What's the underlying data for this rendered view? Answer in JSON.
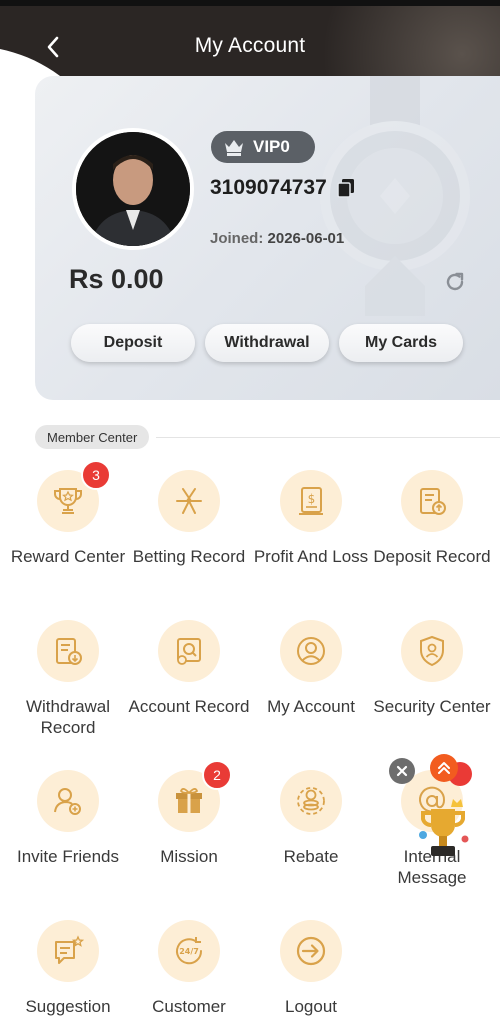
{
  "header": {
    "title": "My Account"
  },
  "profile": {
    "vip_label": "VIP0",
    "user_id": "3109074737",
    "joined_label": "Joined:",
    "joined_date": "2026-06-01",
    "balance": "Rs 0.00"
  },
  "actions": {
    "deposit": "Deposit",
    "withdrawal": "Withdrawal",
    "my_cards": "My Cards"
  },
  "section": {
    "member_center": "Member Center"
  },
  "menu": [
    {
      "label": "Reward Center",
      "icon": "trophy-icon",
      "badge": "3"
    },
    {
      "label": "Betting Record",
      "icon": "betting-record-icon"
    },
    {
      "label": "Profit And Loss",
      "icon": "profit-loss-icon"
    },
    {
      "label": "Deposit Record",
      "icon": "deposit-record-icon"
    },
    {
      "label": "Withdrawal Record",
      "icon": "withdrawal-record-icon"
    },
    {
      "label": "Account Record",
      "icon": "account-record-icon"
    },
    {
      "label": "My Account",
      "icon": "user-icon"
    },
    {
      "label": "Security Center",
      "icon": "shield-icon"
    },
    {
      "label": "Invite Friends",
      "icon": "add-user-icon"
    },
    {
      "label": "Mission",
      "icon": "gift-icon",
      "badge": "2"
    },
    {
      "label": "Rebate",
      "icon": "coins-icon"
    },
    {
      "label": "Internal Message",
      "icon": "at-icon"
    },
    {
      "label": "Suggestion",
      "icon": "suggestion-icon"
    },
    {
      "label": "Customer",
      "icon": "support-24-7-icon"
    },
    {
      "label": "Logout",
      "icon": "logout-icon"
    }
  ],
  "colors": {
    "accent": "#d9a24a",
    "icon_bg": "#fdeed6",
    "header_bg": "#2b2624",
    "badge": "#e93b36"
  }
}
